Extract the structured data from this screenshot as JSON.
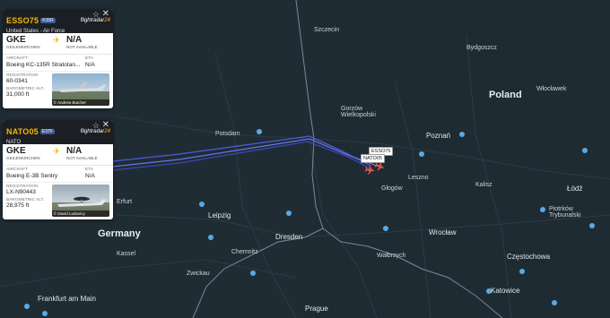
{
  "map": {
    "countries": [
      "Poland",
      "Germany"
    ],
    "cities": [
      "Poznań",
      "Łódź",
      "Wrocław",
      "Leipzig",
      "Dresden",
      "Częstochowa",
      "Katowice",
      "Prague",
      "Potsdam",
      "Frankfurt am Main",
      "Chemnitz",
      "Głogów",
      "Leszno",
      "Kalisz",
      "Piotrków Trybunalski",
      "Gorzów Wielkopolski",
      "Szczecin",
      "Włocławek",
      "Wałbrzych",
      "Zwickau",
      "Erfurt",
      "Kassel",
      "Bydgoszcz"
    ],
    "plane_tag_1": "ESSO75",
    "plane_tag_2": "NATO05"
  },
  "colors": {
    "panel_header": "#1b1f24",
    "callsign": "#f7b500",
    "track": "#5263d6"
  },
  "panels": [
    {
      "callsign": "ESSO75",
      "badge": "K35R",
      "operator": "United States - Air Force",
      "brand_a": "flightradar",
      "brand_b": "24",
      "origin_code": "GKE",
      "origin_name": "GEILENKIRCHEN",
      "dest_code": "N/A",
      "dest_name": "NOT AVAILABLE",
      "aircraft_label": "AIRCRAFT",
      "aircraft": "Boeing KC-135R Stratotan...",
      "eta_label": "ETA",
      "eta": "N/A",
      "reg_label": "REGISTRATION",
      "reg": "60-0341",
      "alt_label": "BAROMETRIC ALT.",
      "alt": "31,000 ft",
      "credit": "© Andrew Butcher"
    },
    {
      "callsign": "NATO05",
      "badge": "E3TF",
      "operator": "NATO",
      "brand_a": "flightradar",
      "brand_b": "24",
      "origin_code": "GKE",
      "origin_name": "GEILENKIRCHEN",
      "dest_code": "N/A",
      "dest_name": "NOT AVAILABLE",
      "aircraft_label": "AIRCRAFT",
      "aircraft": "Boeing E-3B Sentry",
      "eta_label": "ETA",
      "eta": "N/A",
      "reg_label": "REGISTRATION",
      "reg": "LX-N90443",
      "alt_label": "BAROMETRIC ALT.",
      "alt": "28,975 ft",
      "credit": "© David Ludovicy"
    }
  ]
}
